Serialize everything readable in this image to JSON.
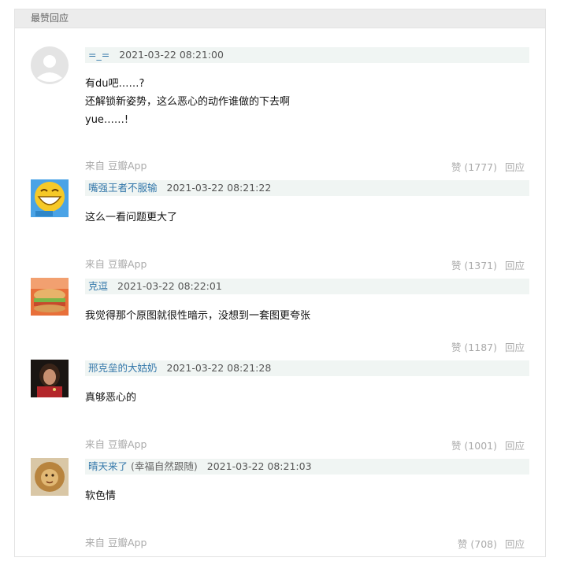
{
  "section": {
    "title": "最赞回应"
  },
  "comments": [
    {
      "author": "=_=",
      "author_note": "",
      "time": "2021-03-22 08:21:00",
      "lines": [
        "有du吧……?",
        "还解锁新姿势，这么恶心的动作谁做的下去啊",
        "yue……!"
      ],
      "source": "来自 豆瓣App",
      "vote_label": "赞 (1777)",
      "reply_label": "回应"
    },
    {
      "author": "嘴强王者不服输",
      "author_note": "",
      "time": "2021-03-22 08:21:22",
      "lines": [
        "这么一看问题更大了"
      ],
      "source": "来自 豆瓣App",
      "vote_label": "赞 (1371)",
      "reply_label": "回应"
    },
    {
      "author": "克逗",
      "author_note": "",
      "time": "2021-03-22 08:22:01",
      "lines": [
        "我觉得那个原图就很性暗示，没想到一套图更夸张"
      ],
      "source": "",
      "vote_label": "赞 (1187)",
      "reply_label": "回应"
    },
    {
      "author": "邢克垒的大姑奶",
      "author_note": "",
      "time": "2021-03-22 08:21:28",
      "lines": [
        "真够恶心的"
      ],
      "source": "来自 豆瓣App",
      "vote_label": "赞 (1001)",
      "reply_label": "回应"
    },
    {
      "author": "晴天来了",
      "author_note": "(幸福自然跟随)",
      "time": "2021-03-22 08:21:03",
      "lines": [
        "软色情"
      ],
      "source": "来自 豆瓣App",
      "vote_label": "赞 (708)",
      "reply_label": "回应"
    }
  ]
}
